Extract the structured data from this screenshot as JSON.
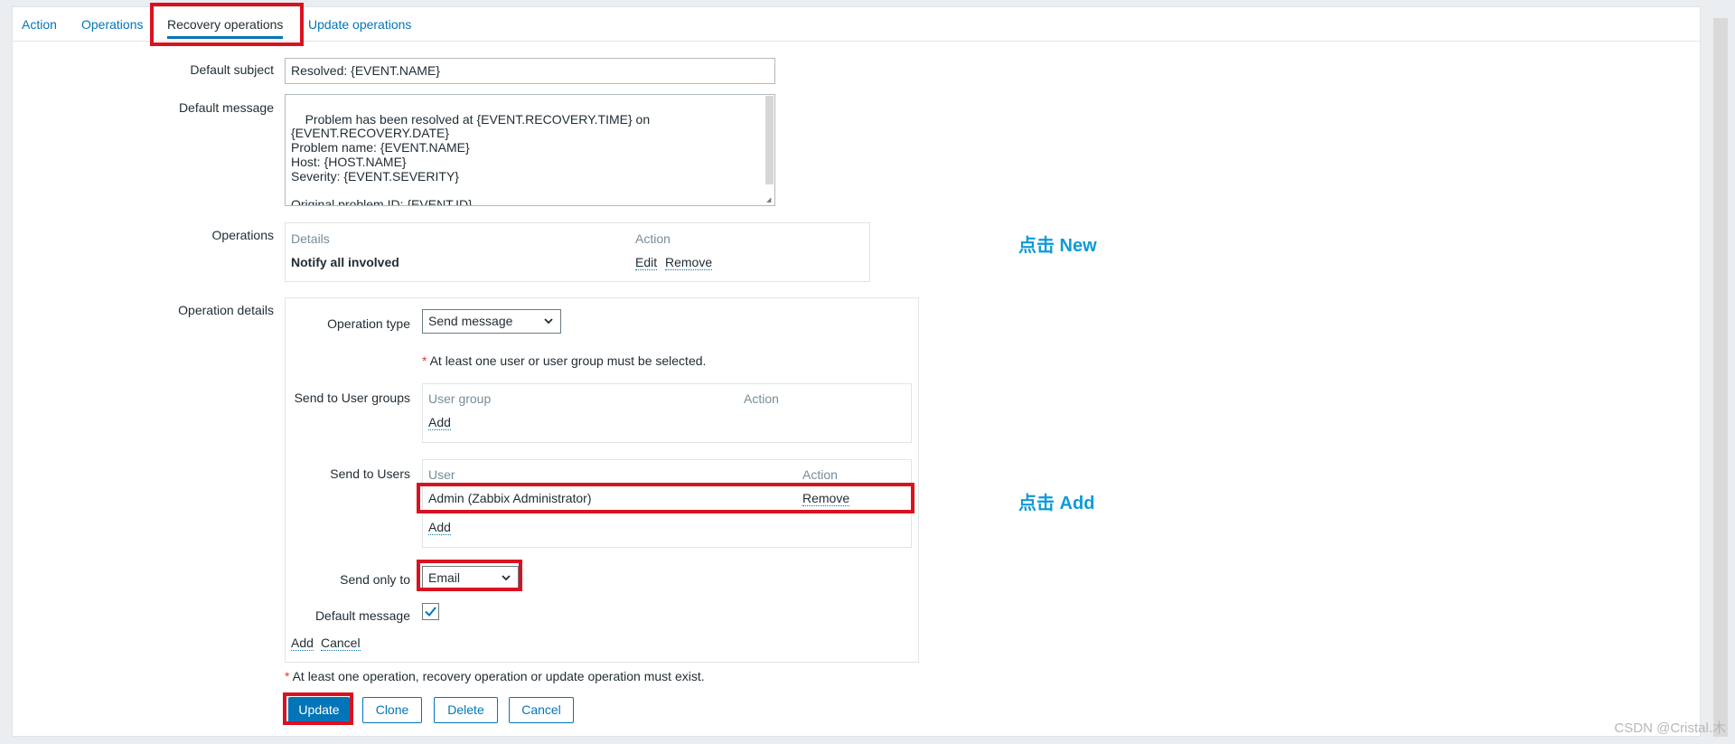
{
  "tabs": [
    "Action",
    "Operations",
    "Recovery operations",
    "Update operations"
  ],
  "form": {
    "default_subject_label": "Default subject",
    "default_subject_value": "Resolved: {EVENT.NAME}",
    "default_message_label": "Default message",
    "default_message_value": "Problem has been resolved at {EVENT.RECOVERY.TIME} on\n{EVENT.RECOVERY.DATE}\nProblem name: {EVENT.NAME}\nHost: {HOST.NAME}\nSeverity: {EVENT.SEVERITY}\n\nOriginal problem ID: {EVENT.ID}\n{TRIGGER.URL}",
    "operations_label": "Operations",
    "operations_table": {
      "headers": [
        "Details",
        "Action"
      ],
      "rows": [
        {
          "details": "Notify all involved",
          "edit": "Edit",
          "remove": "Remove"
        }
      ]
    },
    "operation_details_label": "Operation details",
    "operation_type_label": "Operation type",
    "operation_type_value": "Send message",
    "user_required_hint": "At least one user or user group must be selected.",
    "send_to_user_groups_label": "Send to User groups",
    "user_groups_table": {
      "headers": [
        "User group",
        "Action"
      ],
      "add": "Add"
    },
    "send_to_users_label": "Send to Users",
    "users_table": {
      "headers": [
        "User",
        "Action"
      ],
      "rows": [
        {
          "user": "Admin (Zabbix Administrator)",
          "remove": "Remove"
        }
      ],
      "add": "Add"
    },
    "send_only_to_label": "Send only to",
    "send_only_to_value": "Email",
    "default_message_checkbox_label": "Default message",
    "default_message_checked": true,
    "details_add": "Add",
    "details_cancel": "Cancel",
    "operation_required_hint": "At least one operation, recovery operation or update operation must exist.",
    "star": "*"
  },
  "buttons": {
    "update": "Update",
    "clone": "Clone",
    "delete": "Delete",
    "cancel": "Cancel"
  },
  "annotations": {
    "new_note": "点击 New",
    "add_note": "点击 Add"
  },
  "watermark": "CSDN @Cristal.木",
  "colors": {
    "link": "#0275b8",
    "highlight": "#d9121f",
    "note": "#0d9ad9",
    "required": "#e33734"
  }
}
